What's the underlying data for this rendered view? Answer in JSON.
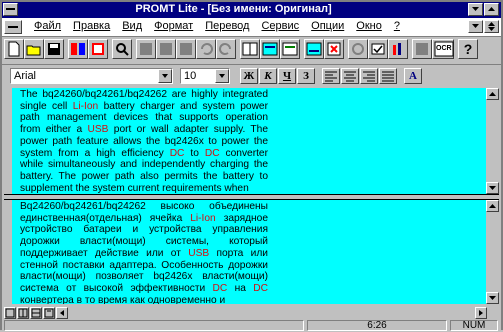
{
  "window": {
    "title": "PROMT Lite - [Без имени: Оригинал]"
  },
  "menu": {
    "items": [
      "Файл",
      "Правка",
      "Вид",
      "Формат",
      "Перевод",
      "Сервис",
      "Опции",
      "Окно",
      "?"
    ]
  },
  "toolbar": {
    "icons": [
      "new-document-icon",
      "open-folder-icon",
      "save-disk-icon",
      "translate-icon",
      "dictionary-icon",
      "find-icon",
      "cut-icon",
      "copy-icon",
      "paste-icon",
      "undo-icon",
      "redo-icon",
      "layout-icon",
      "translate-text-icon",
      "translate-paragraph-icon",
      "translate-all-icon",
      "stop-icon",
      "check-icon",
      "spellcheck-icon",
      "ocr-icon",
      "help-icon"
    ],
    "ocr_label": "OCR",
    "help_label": "?"
  },
  "format": {
    "font_name": "Arial",
    "font_size": "10",
    "bold": "Ж",
    "italic": "К",
    "underline": "Ч",
    "strike": "З",
    "az": "A"
  },
  "source": {
    "segments": [
      {
        "t": "The bq24260/bq24261/bq24262 are highly integrated single cell "
      },
      {
        "t": "Li-Ion",
        "h": true
      },
      {
        "t": " battery charger and system power path management devices that supports operation from either a "
      },
      {
        "t": "USB",
        "h": true
      },
      {
        "t": " port or wall adapter supply. The power path feature allows the bq2426x to power the system from a high efficiency "
      },
      {
        "t": "DC",
        "h": true
      },
      {
        "t": " to "
      },
      {
        "t": "DC",
        "h": true
      },
      {
        "t": " converter while simultaneously and independently charging the battery. The power path also permits the battery to supplement the system current requirements when"
      }
    ]
  },
  "translation": {
    "segments": [
      {
        "t": "Bq24260/bq24261/bq24262 высоко объединены единственная(отдельная) ячейка "
      },
      {
        "t": "Li-Ion",
        "h": true
      },
      {
        "t": " зарядное устройство батареи и устройства управления дорожки власти(мощи) системы, который поддерживает действие или от "
      },
      {
        "t": "USB",
        "h": true
      },
      {
        "t": " порта или стенной поставки адаптера. Особенность дорожки власти(мощи) позволяет bq2426x власти(мощи) система от высокой эффективности "
      },
      {
        "t": "DC",
        "h": true
      },
      {
        "t": " на "
      },
      {
        "t": "DC",
        "h": true
      },
      {
        "t": " конвертера в то время как одновременно и"
      }
    ]
  },
  "status": {
    "time": "6:26",
    "num": "NUM"
  }
}
